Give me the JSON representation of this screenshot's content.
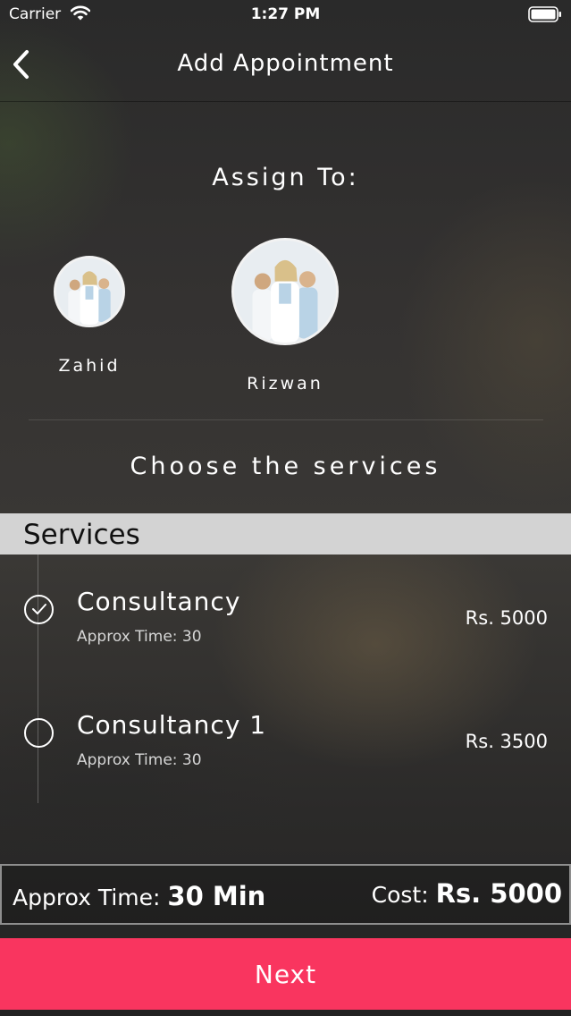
{
  "status_bar": {
    "carrier": "Carrier",
    "time": "1:27 PM"
  },
  "nav": {
    "title": "Add Appointment",
    "back_icon": "chevron-left-icon"
  },
  "assign": {
    "heading": "Assign To:",
    "staff": [
      {
        "name": "Zahid",
        "selected": false
      },
      {
        "name": "Rizwan",
        "selected": true
      }
    ]
  },
  "choose_heading": "Choose the services",
  "services": {
    "header": "Services",
    "items": [
      {
        "name": "Consultancy",
        "time": "Approx Time: 30",
        "price": "Rs. 5000",
        "checked": true
      },
      {
        "name": "Consultancy 1",
        "time": "Approx Time: 30",
        "price": "Rs. 3500",
        "checked": false
      }
    ]
  },
  "summary": {
    "time_label": "Approx Time:",
    "time_value": "30 Min",
    "cost_label": "Cost:",
    "cost_value": "Rs. 5000"
  },
  "next_button": "Next",
  "colors": {
    "accent": "#f9355f",
    "header_bg": "#d3d3d3"
  }
}
